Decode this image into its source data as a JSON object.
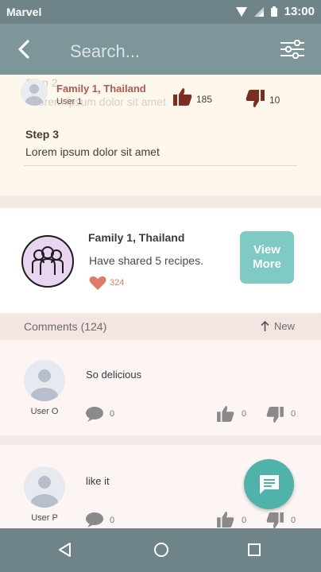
{
  "status_bar": {
    "carrier": "Marvel",
    "time": "13:00"
  },
  "search": {
    "placeholder": "Search..."
  },
  "steps": {
    "ghost_step_label": "Step 2",
    "ghost_step_body": "Lorem ipsum dolor sit amet",
    "step3_title": "Step 3",
    "step3_body": "Lorem ipsum dolor sit amet"
  },
  "overlay": {
    "name": "Family 1, Thailand",
    "user": "User 1",
    "likes": "185",
    "dislikes": "10"
  },
  "family": {
    "name": "Family 1, Thailand",
    "description": "Have shared 5 recipes.",
    "likes": "324",
    "view_more_label": "View More"
  },
  "comments_header": {
    "count_label": "Comments (124)",
    "sort_label": "New"
  },
  "comments": [
    {
      "user": "User O",
      "text": "So delicious",
      "replies": "0",
      "likes": "0",
      "dislikes": "0"
    },
    {
      "user": "User P",
      "text": "like it",
      "replies": "0",
      "likes": "0",
      "dislikes": "0"
    }
  ],
  "colors": {
    "accent": "#7fcac4",
    "fab": "#4fb3a9",
    "header": "#7e969a"
  }
}
